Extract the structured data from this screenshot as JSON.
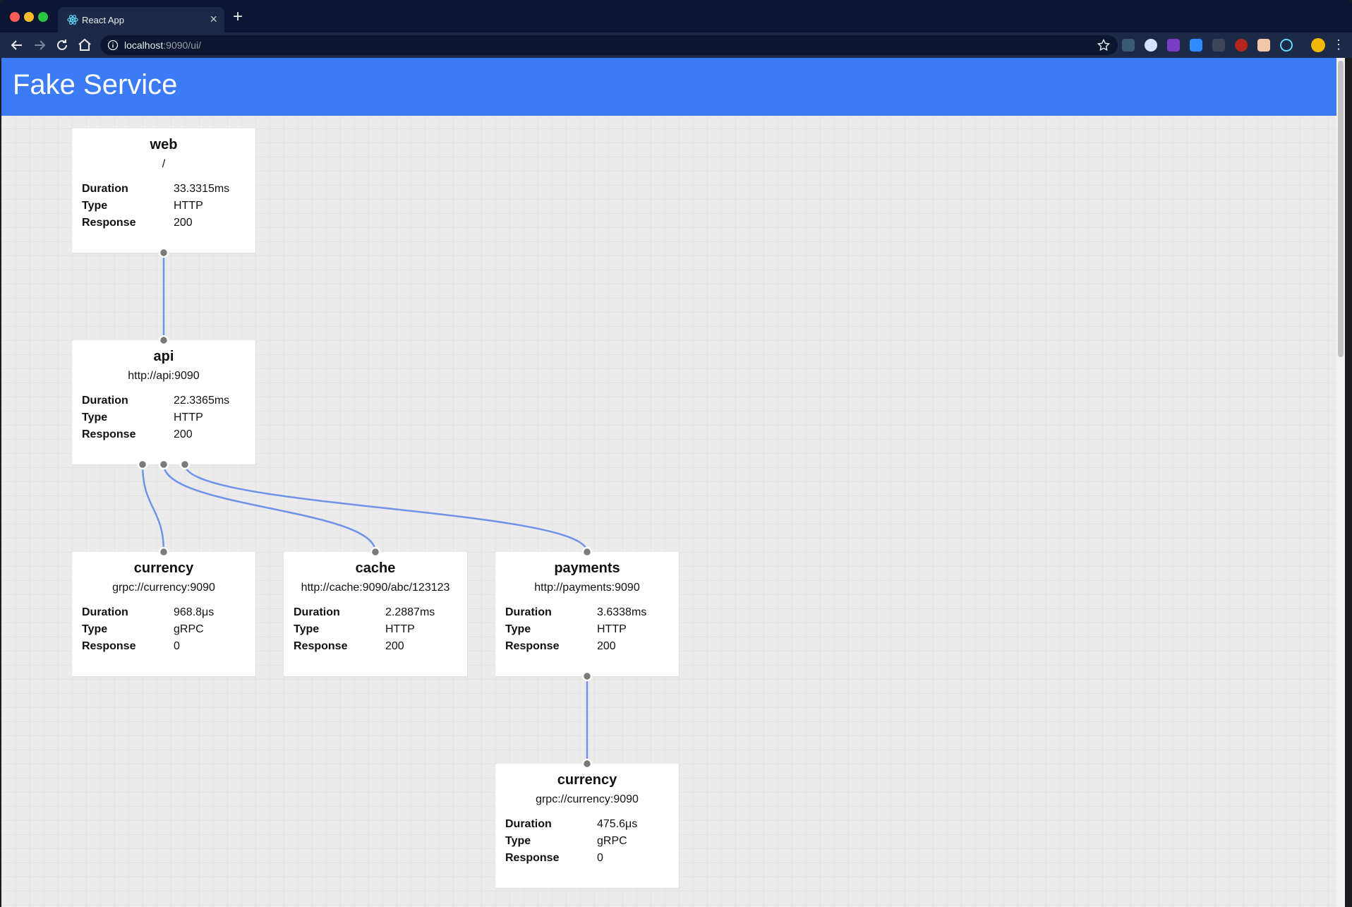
{
  "browser": {
    "tab_title": "React App",
    "tab_close": "×",
    "new_tab": "+",
    "url_host": "localhost",
    "url_path": ":9090/ui/",
    "menu": "⋮"
  },
  "page": {
    "title": "Fake Service"
  },
  "colors": {
    "header": "#3b7bf6",
    "edge": "#6e93e8",
    "port": "#7a7a7a"
  },
  "labels": {
    "duration": "Duration",
    "type": "Type",
    "response": "Response"
  },
  "services": [
    {
      "id": "web",
      "name": "web",
      "uri": "/",
      "duration": "33.3315ms",
      "type": "HTTP",
      "response": "200"
    },
    {
      "id": "api",
      "name": "api",
      "uri": "http://api:9090",
      "duration": "22.3365ms",
      "type": "HTTP",
      "response": "200"
    },
    {
      "id": "currency1",
      "name": "currency",
      "uri": "grpc://currency:9090",
      "duration": "968.8μs",
      "type": "gRPC",
      "response": "0"
    },
    {
      "id": "cache",
      "name": "cache",
      "uri": "http://cache:9090/abc/123123",
      "duration": "2.2887ms",
      "type": "HTTP",
      "response": "200"
    },
    {
      "id": "payments",
      "name": "payments",
      "uri": "http://payments:9090",
      "duration": "3.6338ms",
      "type": "HTTP",
      "response": "200"
    },
    {
      "id": "currency2",
      "name": "currency",
      "uri": "grpc://currency:9090",
      "duration": "475.6μs",
      "type": "gRPC",
      "response": "0"
    }
  ],
  "edges": [
    {
      "from": "web",
      "to": "api"
    },
    {
      "from": "api",
      "to": "currency1"
    },
    {
      "from": "api",
      "to": "cache"
    },
    {
      "from": "api",
      "to": "payments"
    },
    {
      "from": "payments",
      "to": "currency2"
    }
  ]
}
